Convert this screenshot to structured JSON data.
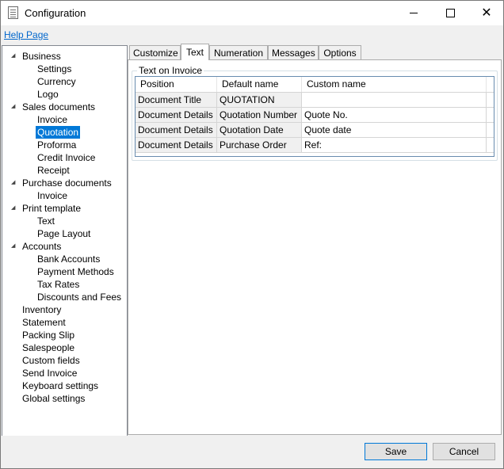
{
  "window": {
    "title": "Configuration",
    "minimize_icon": "minimize-icon",
    "maximize_icon": "maximize-icon",
    "close_icon": "close-icon",
    "close_glyph": "✕"
  },
  "help_link": "Help Page",
  "tree": [
    {
      "label": "Business",
      "level": 0,
      "expander": true
    },
    {
      "label": "Settings",
      "level": 1
    },
    {
      "label": "Currency",
      "level": 1
    },
    {
      "label": "Logo",
      "level": 1
    },
    {
      "label": "Sales documents",
      "level": 0,
      "expander": true
    },
    {
      "label": "Invoice",
      "level": 1
    },
    {
      "label": "Quotation",
      "level": 1,
      "selected": true
    },
    {
      "label": "Proforma",
      "level": 1
    },
    {
      "label": "Credit Invoice",
      "level": 1
    },
    {
      "label": "Receipt",
      "level": 1
    },
    {
      "label": "Purchase documents",
      "level": 0,
      "expander": true
    },
    {
      "label": "Invoice",
      "level": 1
    },
    {
      "label": "Print template",
      "level": 0,
      "expander": true
    },
    {
      "label": "Text",
      "level": 1
    },
    {
      "label": "Page Layout",
      "level": 1
    },
    {
      "label": "Accounts",
      "level": 0,
      "expander": true
    },
    {
      "label": "Bank Accounts",
      "level": 1
    },
    {
      "label": "Payment Methods",
      "level": 1
    },
    {
      "label": "Tax Rates",
      "level": 1
    },
    {
      "label": "Discounts and Fees",
      "level": 1
    },
    {
      "label": "Inventory",
      "level": 0
    },
    {
      "label": "Statement",
      "level": 0
    },
    {
      "label": "Packing Slip",
      "level": 0
    },
    {
      "label": "Salespeople",
      "level": 0
    },
    {
      "label": "Custom fields",
      "level": 0
    },
    {
      "label": "Send Invoice",
      "level": 0
    },
    {
      "label": "Keyboard settings",
      "level": 0
    },
    {
      "label": "Global settings",
      "level": 0
    }
  ],
  "tabs": [
    {
      "label": "Customize"
    },
    {
      "label": "Text",
      "active": true
    },
    {
      "label": "Numeration"
    },
    {
      "label": "Messages"
    },
    {
      "label": "Options"
    }
  ],
  "group_title": "Text on Invoice",
  "table": {
    "columns": [
      "Position",
      "Default name",
      "Custom name"
    ],
    "rows": [
      [
        "Document Title",
        "QUOTATION",
        ""
      ],
      [
        "Document Details",
        "Quotation Number",
        "Quote No."
      ],
      [
        "Document Details",
        "Quotation Date",
        "Quote date"
      ],
      [
        "Document Details",
        "Purchase Order",
        "Ref:"
      ]
    ]
  },
  "buttons": {
    "save": "Save",
    "cancel": "Cancel"
  },
  "colors": {
    "selection": "#0078d7",
    "link": "#0066cc",
    "grid_border": "#688caf"
  }
}
